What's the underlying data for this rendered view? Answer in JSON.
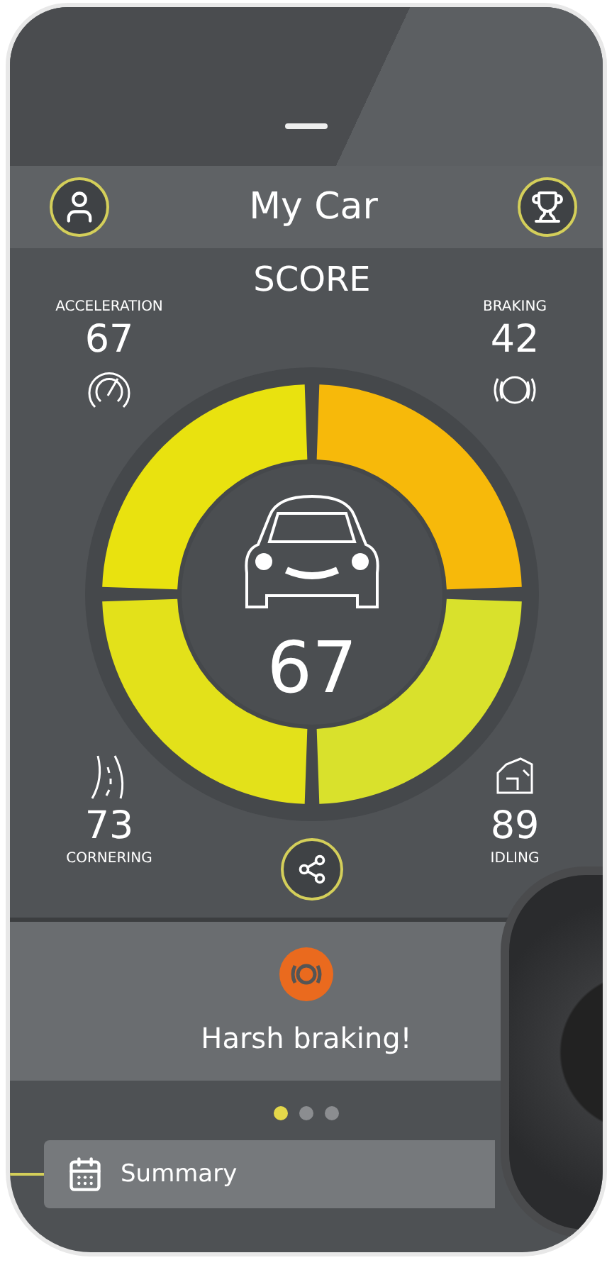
{
  "header": {
    "title": "My Car"
  },
  "score": {
    "title": "SCORE",
    "total": "67"
  },
  "metrics": [
    {
      "kind": "acceleration",
      "label": "ACCELERATION",
      "value": "67",
      "color": "#e9e20f"
    },
    {
      "kind": "braking",
      "label": "BRAKING",
      "value": "42",
      "color": "#f7b90a"
    },
    {
      "kind": "cornering",
      "label": "CORNERING",
      "value": "73",
      "color": "#e3e11a"
    },
    {
      "kind": "idling",
      "label": "IDLING",
      "value": "89",
      "color": "#d9e12c"
    }
  ],
  "alert": {
    "message": "Harsh braking!"
  },
  "pages": [
    {
      "selected": true
    },
    {
      "selected": false
    },
    {
      "selected": false
    }
  ],
  "summary": {
    "label": "Summary"
  }
}
